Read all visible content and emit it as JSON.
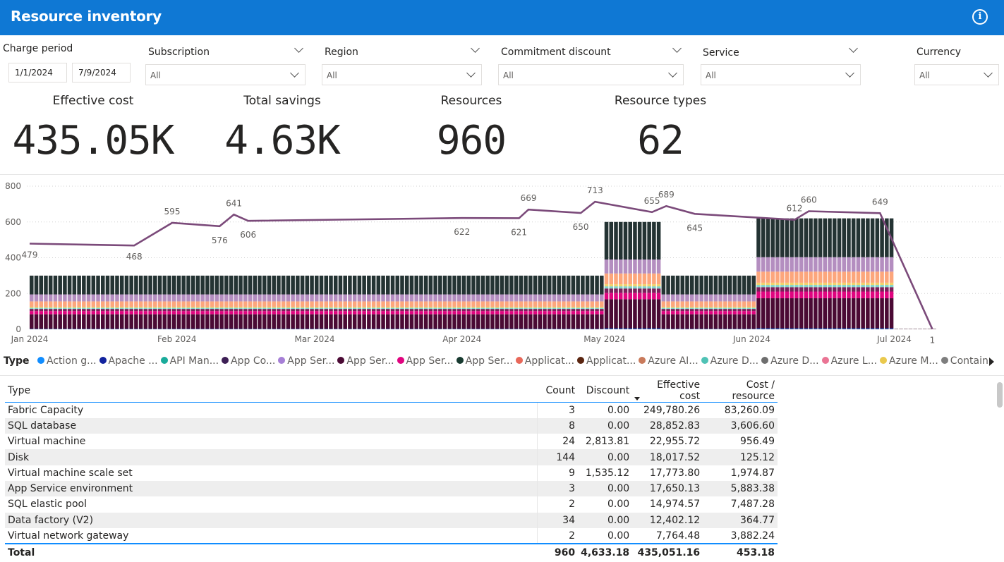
{
  "header": {
    "title": "Resource inventory",
    "info_icon": "info-icon"
  },
  "filters": {
    "charge_period": {
      "label": "Charge period",
      "start": "1/1/2024",
      "end": "7/9/2024"
    },
    "subscription": {
      "label": "Subscription",
      "value": "All"
    },
    "region": {
      "label": "Region",
      "value": "All"
    },
    "commitment_discount": {
      "label": "Commitment discount",
      "value": "All"
    },
    "service": {
      "label": "Service",
      "value": "All"
    },
    "currency": {
      "label": "Currency",
      "value": "All"
    }
  },
  "kpis": {
    "effective_cost": {
      "label": "Effective cost",
      "value": "435.05K"
    },
    "total_savings": {
      "label": "Total savings",
      "value": "4.63K"
    },
    "resources": {
      "label": "Resources",
      "value": "960"
    },
    "resource_types": {
      "label": "Resource types",
      "value": "62"
    }
  },
  "chart_data": {
    "type": "bar",
    "stacked": true,
    "combo_line": true,
    "ylim": [
      0,
      800
    ],
    "yticks": [
      0,
      200,
      400,
      600,
      800
    ],
    "xticks": [
      "Jan 2024",
      "Feb 2024",
      "Mar 2024",
      "Apr 2024",
      "May 2024",
      "Jun 2024",
      "Jul 2024"
    ],
    "grid": true,
    "bar_periods": [
      {
        "from": "2024-01-01",
        "to": "2024-04-30",
        "total": 300
      },
      {
        "from": "2024-05-01",
        "to": "2024-05-12",
        "total": 600
      },
      {
        "from": "2024-05-13",
        "to": "2024-06-01",
        "total": 300
      },
      {
        "from": "2024-06-02",
        "to": "2024-06-30",
        "total": 620
      },
      {
        "from": "2024-07-01",
        "to": "2024-07-09",
        "total": 3
      }
    ],
    "stack_segments": [
      {
        "color": "#1f3f99",
        "share": 0.01
      },
      {
        "color": "#4a0a34",
        "share": 0.27
      },
      {
        "color": "#e0047f",
        "share": 0.06
      },
      {
        "color": "#7a1f5a",
        "share": 0.04
      },
      {
        "color": "#7fd3c8",
        "share": 0.02
      },
      {
        "color": "#f2d16b",
        "share": 0.02
      },
      {
        "color": "#fca67c",
        "share": 0.1
      },
      {
        "color": "#b48ec0",
        "share": 0.13
      },
      {
        "color": "#243333",
        "share": 0.35
      }
    ],
    "line": {
      "color": "#7b4a7a",
      "labels": [
        {
          "date": "2024-01-01",
          "value": "479"
        },
        {
          "date": "2024-01-23",
          "value": "468"
        },
        {
          "date": "2024-01-31",
          "value": "595"
        },
        {
          "date": "2024-02-10",
          "value": "576"
        },
        {
          "date": "2024-02-13",
          "value": "641"
        },
        {
          "date": "2024-02-16",
          "value": "606"
        },
        {
          "date": "2024-04-01",
          "value": "622"
        },
        {
          "date": "2024-04-13",
          "value": "621"
        },
        {
          "date": "2024-04-15",
          "value": "669"
        },
        {
          "date": "2024-04-26",
          "value": "650"
        },
        {
          "date": "2024-04-29",
          "value": "713"
        },
        {
          "date": "2024-05-11",
          "value": "655"
        },
        {
          "date": "2024-05-14",
          "value": "689"
        },
        {
          "date": "2024-05-20",
          "value": "645"
        },
        {
          "date": "2024-06-13",
          "value": "660"
        },
        {
          "date": "2024-06-10",
          "value": "612"
        },
        {
          "date": "2024-06-28",
          "value": "649"
        },
        {
          "date": "2024-07-09",
          "value": "1"
        }
      ]
    }
  },
  "legend": {
    "title": "Type",
    "items": [
      {
        "label": "Action g...",
        "color": "#118dff"
      },
      {
        "label": "Apache ...",
        "color": "#12239e"
      },
      {
        "label": "API Man...",
        "color": "#1aab9b"
      },
      {
        "label": "App Co...",
        "color": "#3d1f55"
      },
      {
        "label": "App Ser...",
        "color": "#a67fd6"
      },
      {
        "label": "App Ser...",
        "color": "#4a0a34"
      },
      {
        "label": "App Ser...",
        "color": "#e0047f"
      },
      {
        "label": "App Ser...",
        "color": "#183a30"
      },
      {
        "label": "Applicat...",
        "color": "#e8685a"
      },
      {
        "label": "Applicat...",
        "color": "#5a2510"
      },
      {
        "label": "Azure AI...",
        "color": "#c97a5b"
      },
      {
        "label": "Azure D...",
        "color": "#4fc2b5"
      },
      {
        "label": "Azure D...",
        "color": "#6e6e6e"
      },
      {
        "label": "Azure L...",
        "color": "#ea7494"
      },
      {
        "label": "Azure M...",
        "color": "#eac94d"
      },
      {
        "label": "Contain...",
        "color": "#7e7e7e"
      }
    ]
  },
  "table": {
    "columns": [
      "Type",
      "Count",
      "Discount",
      "Effective cost",
      "Cost / resource"
    ],
    "rows": [
      [
        "Fabric Capacity",
        "3",
        "0.00",
        "249,780.26",
        "83,260.09"
      ],
      [
        "SQL database",
        "8",
        "0.00",
        "28,852.83",
        "3,606.60"
      ],
      [
        "Virtual machine",
        "24",
        "2,813.81",
        "22,955.72",
        "956.49"
      ],
      [
        "Disk",
        "144",
        "0.00",
        "18,017.52",
        "125.12"
      ],
      [
        "Virtual machine scale set",
        "9",
        "1,535.12",
        "17,773.80",
        "1,974.87"
      ],
      [
        "App Service environment",
        "3",
        "0.00",
        "17,650.13",
        "5,883.38"
      ],
      [
        "SQL elastic pool",
        "2",
        "0.00",
        "14,974.57",
        "7,487.28"
      ],
      [
        "Data factory (V2)",
        "34",
        "0.00",
        "12,402.12",
        "364.77"
      ],
      [
        "Virtual network gateway",
        "2",
        "0.00",
        "7,764.48",
        "3,882.24"
      ]
    ],
    "total": [
      "Total",
      "960",
      "4,633.18",
      "435,051.16",
      "453.18"
    ]
  }
}
